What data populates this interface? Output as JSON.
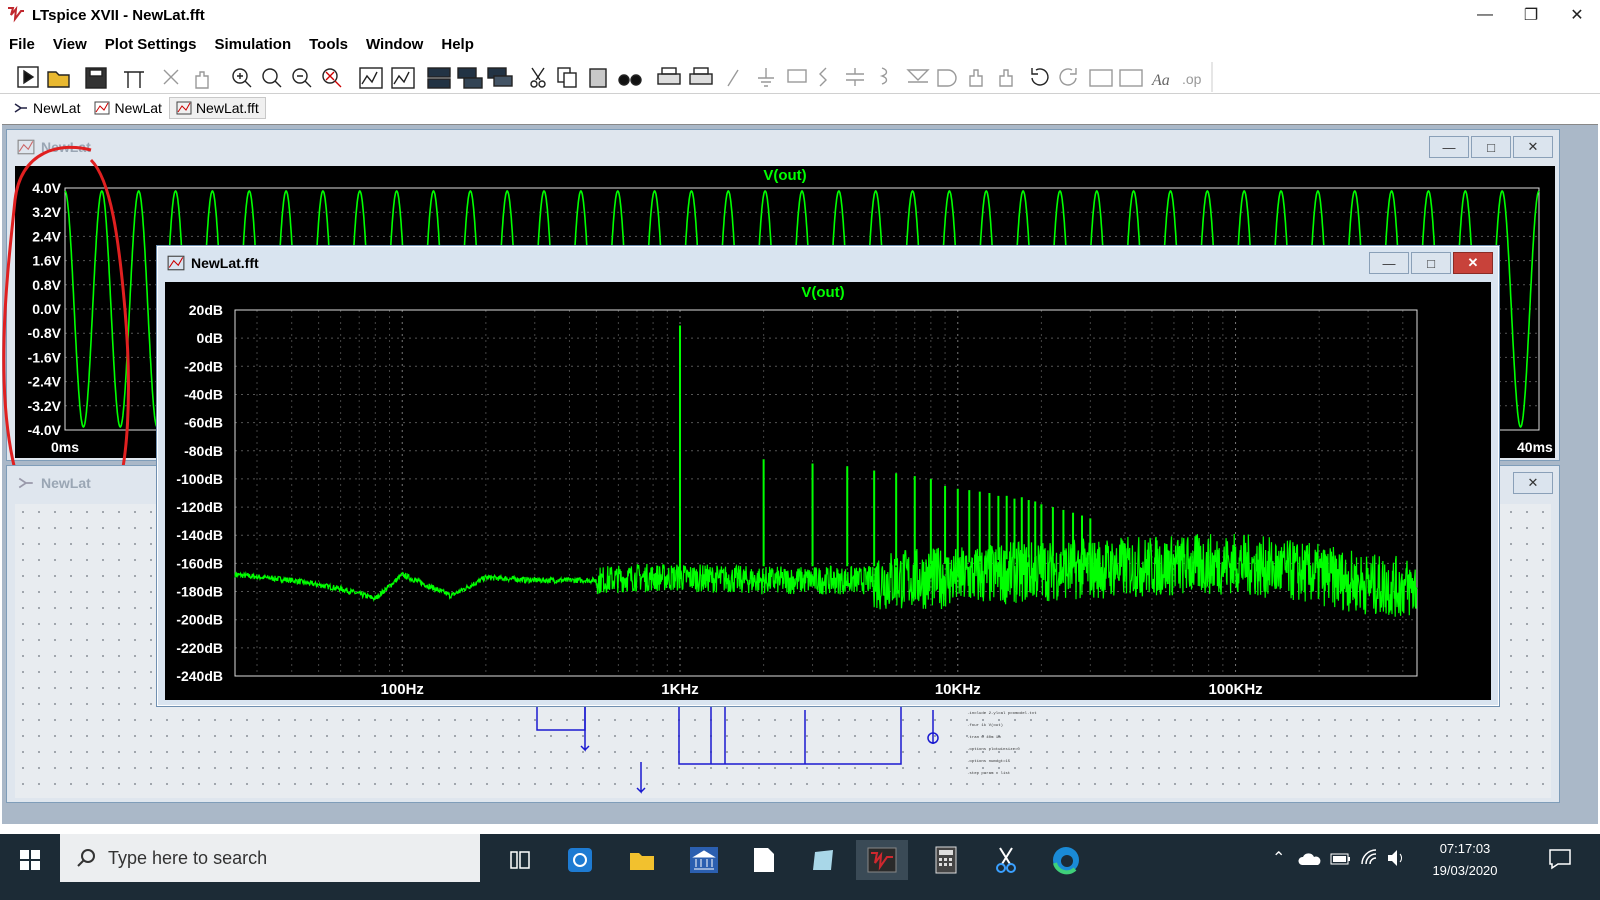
{
  "window": {
    "title": "LTspice XVII - NewLat.fft"
  },
  "menu": [
    "File",
    "View",
    "Plot Settings",
    "Simulation",
    "Tools",
    "Window",
    "Help"
  ],
  "tabs": [
    {
      "label": "NewLat",
      "icon": "schematic-icon",
      "active": false
    },
    {
      "label": "NewLat",
      "icon": "waveform-icon",
      "active": false
    },
    {
      "label": "NewLat.fft",
      "icon": "waveform-icon",
      "active": true
    }
  ],
  "wave_window": {
    "title": "NewLat",
    "trace_label": "V(out)",
    "x_start": "0ms",
    "x_end": "40ms"
  },
  "schematic_window": {
    "title": "NewLat"
  },
  "fft_window": {
    "title": "NewLat.fft",
    "trace_label": "V(out)"
  },
  "chart_data": [
    {
      "type": "line",
      "title": "V(out)",
      "xlabel": "",
      "ylabel": "",
      "x_ticks": [
        "0ms",
        "40ms"
      ],
      "y_ticks": [
        "4.0V",
        "3.2V",
        "2.4V",
        "1.6V",
        "0.8V",
        "0.0V",
        "-0.8V",
        "-1.6V",
        "-2.4V",
        "-3.2V",
        "-4.0V"
      ],
      "ylim": [
        -4.0,
        4.0
      ],
      "xlim": [
        0,
        40
      ],
      "x_unit": "ms",
      "grid": true,
      "series": [
        {
          "name": "V(out)",
          "color": "#00ff00",
          "waveform": "sine",
          "cycles": 40,
          "amplitude": 3.9
        }
      ]
    },
    {
      "type": "line",
      "title": "V(out)",
      "xlabel": "",
      "ylabel": "",
      "x_scale": "log",
      "x_ticks": [
        "100Hz",
        "1KHz",
        "10KHz",
        "100KHz"
      ],
      "y_ticks": [
        "20dB",
        "0dB",
        "-20dB",
        "-40dB",
        "-60dB",
        "-80dB",
        "-100dB",
        "-120dB",
        "-140dB",
        "-160dB",
        "-180dB",
        "-200dB",
        "-220dB",
        "-240dB"
      ],
      "ylim": [
        -240,
        20
      ],
      "xlim": [
        25,
        450000
      ],
      "grid": true,
      "series": [
        {
          "name": "V(out)",
          "color": "#00ff00",
          "fundamental": {
            "freq": 1000,
            "db": 9
          },
          "harmonics_db": [
            [
              2000,
              -86
            ],
            [
              3000,
              -89
            ],
            [
              4000,
              -91
            ],
            [
              5000,
              -94
            ],
            [
              6000,
              -96
            ],
            [
              7000,
              -98
            ],
            [
              8000,
              -100
            ],
            [
              9000,
              -105
            ],
            [
              10000,
              -107
            ],
            [
              11000,
              -108
            ],
            [
              12000,
              -109
            ],
            [
              13000,
              -110
            ],
            [
              14000,
              -112
            ],
            [
              15000,
              -112
            ],
            [
              16000,
              -114
            ],
            [
              17000,
              -113
            ],
            [
              18000,
              -115
            ],
            [
              19000,
              -116
            ],
            [
              20000,
              -118
            ],
            [
              22000,
              -120
            ],
            [
              24000,
              -122
            ],
            [
              26000,
              -124
            ],
            [
              28000,
              -126
            ],
            [
              30000,
              -128
            ]
          ],
          "noise_floor_db": [
            [
              25,
              -168
            ],
            [
              40,
              -172
            ],
            [
              60,
              -178
            ],
            [
              80,
              -185
            ],
            [
              100,
              -168
            ],
            [
              150,
              -183
            ],
            [
              200,
              -170
            ],
            [
              300,
              -172
            ],
            [
              500,
              -172
            ],
            [
              700,
              -170
            ],
            [
              1000,
              -170
            ],
            [
              2000,
              -172
            ],
            [
              5000,
              -172
            ],
            [
              10000,
              -170
            ],
            [
              20000,
              -165
            ],
            [
              50000,
              -162
            ],
            [
              100000,
              -160
            ],
            [
              200000,
              -168
            ],
            [
              300000,
              -175
            ],
            [
              450000,
              -178
            ]
          ]
        }
      ]
    }
  ]
}
